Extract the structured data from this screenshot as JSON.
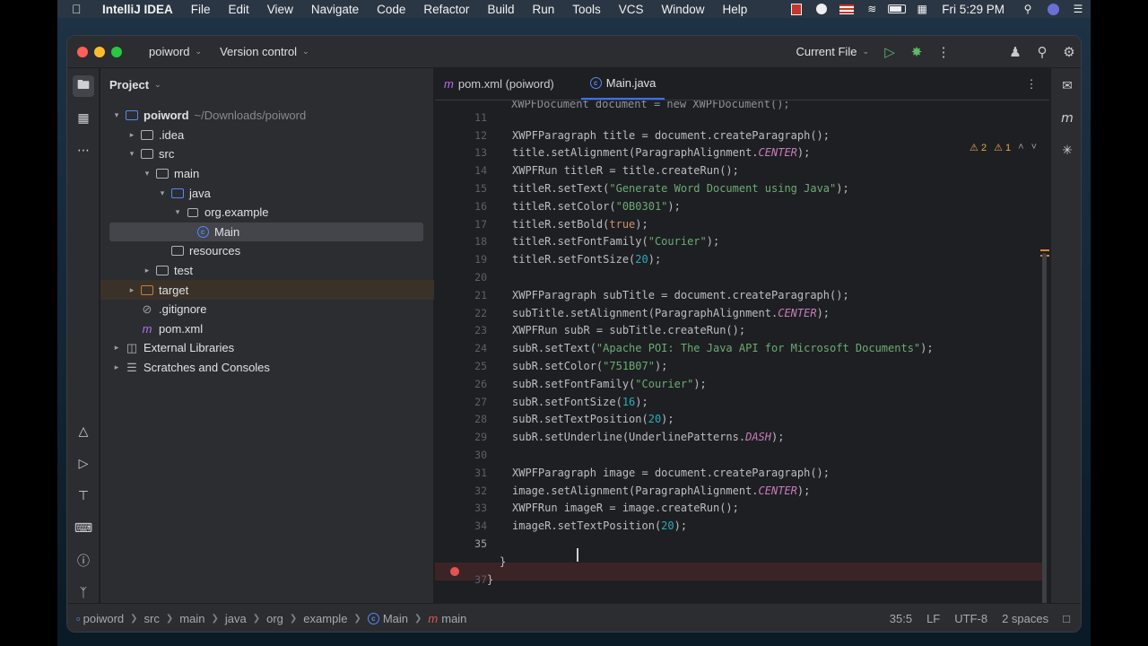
{
  "menubar": {
    "app": "IntelliJ IDEA",
    "menus": [
      "File",
      "Edit",
      "View",
      "Navigate",
      "Code",
      "Refactor",
      "Build",
      "Run",
      "Tools",
      "VCS",
      "Window",
      "Help"
    ],
    "clock": "Fri 5:29 PM",
    "status_icons": [
      "record-icon",
      "lastpass-icon",
      "flag-icon",
      "wifi-icon",
      "battery-icon",
      "search-icon",
      "user-icon",
      "control-center-icon"
    ]
  },
  "titlebar": {
    "project": "poiword",
    "vcs": "Version control",
    "run_config": "Current File"
  },
  "project_panel": {
    "title": "Project",
    "tree": [
      {
        "label": "poiword",
        "hint": "~/Downloads/poiword",
        "type": "module",
        "arrow": "down",
        "level": 0,
        "bold": true
      },
      {
        "label": ".idea",
        "type": "folder",
        "arrow": "right",
        "level": 1
      },
      {
        "label": "src",
        "type": "folder",
        "arrow": "down",
        "level": 1
      },
      {
        "label": "main",
        "type": "folder",
        "arrow": "down",
        "level": 2
      },
      {
        "label": "java",
        "type": "folder-blue",
        "arrow": "down",
        "level": 3
      },
      {
        "label": "org.example",
        "type": "package",
        "arrow": "down",
        "level": 4
      },
      {
        "label": "Main",
        "type": "class",
        "arrow": "",
        "level": 5,
        "selected": true
      },
      {
        "label": "resources",
        "type": "folder-res",
        "arrow": "",
        "level": 3
      },
      {
        "label": "test",
        "type": "folder",
        "arrow": "right",
        "level": 2
      },
      {
        "label": "target",
        "type": "folder-orange",
        "arrow": "right",
        "level": 1,
        "excluded": true
      },
      {
        "label": ".gitignore",
        "type": "ignore",
        "arrow": "",
        "level": 1
      },
      {
        "label": "pom.xml",
        "type": "maven",
        "arrow": "",
        "level": 1
      },
      {
        "label": "External Libraries",
        "type": "libs",
        "arrow": "right",
        "level": 0
      },
      {
        "label": "Scratches and Consoles",
        "type": "scratch",
        "arrow": "right",
        "level": 0
      }
    ]
  },
  "editor": {
    "tabs": [
      {
        "label": "pom.xml (poiword)",
        "icon": "maven-icon",
        "active": false
      },
      {
        "label": "Main.java",
        "icon": "class-icon",
        "active": true
      }
    ],
    "inspections": {
      "warnings": "2",
      "weak_warnings": "1"
    },
    "partial_top_line": "XWPFDocument document = new XWPFDocument();",
    "lines": [
      {
        "n": "11",
        "code": ""
      },
      {
        "n": "12",
        "code": "XWPFParagraph title = document.createParagraph();"
      },
      {
        "n": "13",
        "code": "title.setAlignment(ParagraphAlignment.CENTER);"
      },
      {
        "n": "14",
        "code": "XWPFRun titleR = title.createRun();"
      },
      {
        "n": "15",
        "code": "titleR.setText(\"Generate Word Document using Java\");"
      },
      {
        "n": "16",
        "code": "titleR.setColor(\"0B0301\");"
      },
      {
        "n": "17",
        "code": "titleR.setBold(true);"
      },
      {
        "n": "18",
        "code": "titleR.setFontFamily(\"Courier\");"
      },
      {
        "n": "19",
        "code": "titleR.setFontSize(20);"
      },
      {
        "n": "20",
        "code": ""
      },
      {
        "n": "21",
        "code": "XWPFParagraph subTitle = document.createParagraph();"
      },
      {
        "n": "22",
        "code": "subTitle.setAlignment(ParagraphAlignment.CENTER);"
      },
      {
        "n": "23",
        "code": "XWPFRun subR = subTitle.createRun();"
      },
      {
        "n": "24",
        "code": "subR.setText(\"Apache POI: The Java API for Microsoft Documents\");"
      },
      {
        "n": "25",
        "code": "subR.setColor(\"751B07\");"
      },
      {
        "n": "26",
        "code": "subR.setFontFamily(\"Courier\");"
      },
      {
        "n": "27",
        "code": "subR.setFontSize(16);"
      },
      {
        "n": "28",
        "code": "subR.setTextPosition(20);"
      },
      {
        "n": "29",
        "code": "subR.setUnderline(UnderlinePatterns.DASH);"
      },
      {
        "n": "30",
        "code": ""
      },
      {
        "n": "31",
        "code": "XWPFParagraph image = document.createParagraph();"
      },
      {
        "n": "32",
        "code": "image.setAlignment(ParagraphAlignment.CENTER);"
      },
      {
        "n": "33",
        "code": "XWPFRun imageR = image.createRun();"
      },
      {
        "n": "34",
        "code": "imageR.setTextPosition(20);"
      },
      {
        "n": "35",
        "code": ""
      },
      {
        "n": "",
        "code": "}"
      },
      {
        "n": "37",
        "code": "}"
      }
    ]
  },
  "breadcrumb": [
    "poiword",
    "src",
    "main",
    "java",
    "org",
    "example",
    "Main",
    "main"
  ],
  "statusbar": {
    "position": "35:5",
    "line_sep": "LF",
    "encoding": "UTF-8",
    "indent": "2 spaces"
  },
  "colors": {
    "accent": "#3574f0",
    "string": "#6aab73",
    "keyword": "#cf8e6d",
    "constant": "#c77dbb",
    "number": "#2aacb8",
    "breakpoint": "#e55353"
  }
}
